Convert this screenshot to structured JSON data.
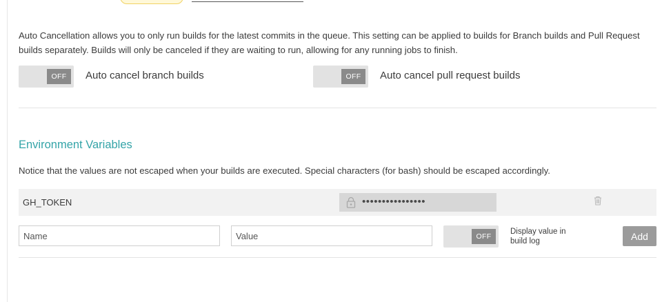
{
  "auto_cancellation": {
    "description": "Auto Cancellation allows you to only run builds for the latest commits in the queue. This setting can be applied to builds for Branch builds and Pull Request builds separately. Builds will only be canceled if they are waiting to run, allowing for any running jobs to finish.",
    "branch_toggle": {
      "state": "OFF",
      "label": "Auto cancel branch builds"
    },
    "pr_toggle": {
      "state": "OFF",
      "label": "Auto cancel pull request builds"
    }
  },
  "env_vars": {
    "title": "Environment Variables",
    "notice": "Notice that the values are not escaped when your builds are executed. Special characters (for bash) should be escaped accordingly.",
    "rows": [
      {
        "name": "GH_TOKEN",
        "value_mask": "••••••••••••••••"
      }
    ],
    "new_var": {
      "name_placeholder": "Name",
      "value_placeholder": "Value",
      "display_toggle_state": "OFF",
      "display_label": "Display value in build log",
      "add_label": "Add"
    }
  },
  "colors": {
    "section_title": "#34a4a8",
    "toggle_track": "#e2e2e2",
    "toggle_knob": "#8a8a8a",
    "add_button": "#9b9b9b"
  }
}
